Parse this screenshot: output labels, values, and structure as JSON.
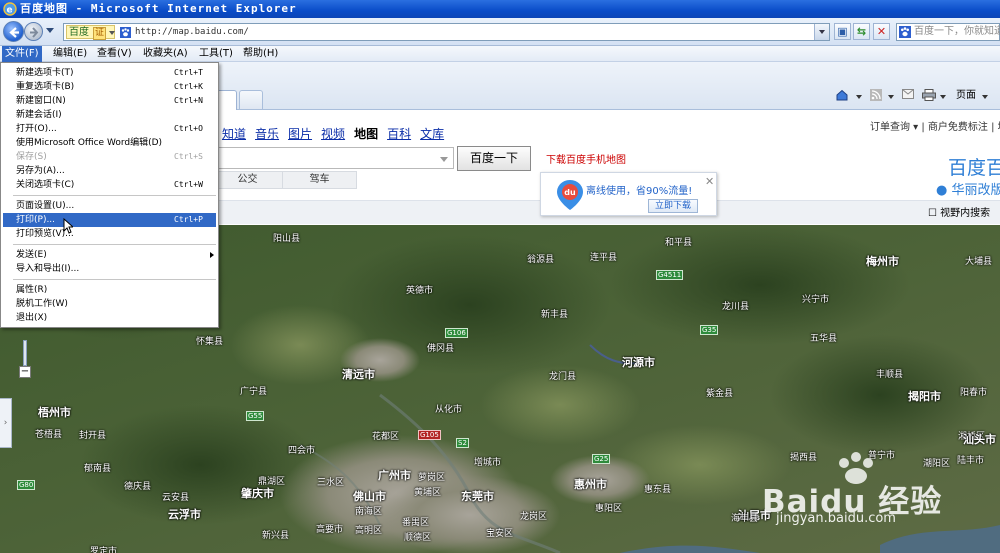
{
  "window": {
    "title": "百度地图 - Microsoft Internet Explorer"
  },
  "address_bar": {
    "site_label": "百度",
    "cert_label": "证",
    "url": "http://map.baidu.com/",
    "search_placeholder": "百度一下，你就知道"
  },
  "menubar": {
    "items": [
      {
        "label": "文件(F)"
      },
      {
        "label": "编辑(E)"
      },
      {
        "label": "查看(V)"
      },
      {
        "label": "收藏夹(A)"
      },
      {
        "label": "工具(T)"
      },
      {
        "label": "帮助(H)"
      }
    ]
  },
  "command_bar": {
    "page_label": "页面"
  },
  "file_menu": {
    "items": [
      {
        "label": "新建选项卡(T)",
        "shortcut": "Ctrl+T"
      },
      {
        "label": "重复选项卡(B)",
        "shortcut": "Ctrl+K"
      },
      {
        "label": "新建窗口(N)",
        "shortcut": "Ctrl+N"
      },
      {
        "label": "新建会话(I)",
        "shortcut": ""
      },
      {
        "label": "打开(O)...",
        "shortcut": "Ctrl+O"
      },
      {
        "label": "使用Microsoft Office Word编辑(D)",
        "shortcut": ""
      },
      {
        "label": "保存(S)",
        "shortcut": "Ctrl+S"
      },
      {
        "label": "另存为(A)...",
        "shortcut": ""
      },
      {
        "label": "关闭选项卡(C)",
        "shortcut": "Ctrl+W"
      },
      {
        "label": "页面设置(U)...",
        "shortcut": ""
      },
      {
        "label": "打印(P)...",
        "shortcut": "Ctrl+P"
      },
      {
        "label": "打印预览(V)...",
        "shortcut": ""
      },
      {
        "label": "发送(E)",
        "shortcut": ""
      },
      {
        "label": "导入和导出(I)...",
        "shortcut": ""
      },
      {
        "label": "属性(R)",
        "shortcut": ""
      },
      {
        "label": "脱机工作(W)",
        "shortcut": ""
      },
      {
        "label": "退出(X)",
        "shortcut": ""
      }
    ]
  },
  "page": {
    "nav_links": [
      "知道",
      "音乐",
      "图片",
      "视频",
      "地图",
      "百科",
      "文库"
    ],
    "top_links": "订单查询 ▾ | 商户免费标注 | 地",
    "search_button": "百度一下",
    "download_link": "下载百度手机地图",
    "route_tabs": [
      "公交",
      "驾车"
    ],
    "brand_logo": "百度百",
    "brand_sub": "● 华丽改版",
    "view_search": "视野内搜索",
    "promo": {
      "text": "离线使用，省90%流量!",
      "button": "立即下载",
      "logo": "du"
    }
  },
  "map": {
    "places": [
      "阳山县",
      "翁源县",
      "连平县",
      "和平县",
      "梅州市",
      "大埔县",
      "英德市",
      "新丰县",
      "龙川县",
      "兴宁市",
      "怀集县",
      "佛冈县",
      "五华县",
      "清远市",
      "龙门县",
      "河源市",
      "丰顺县",
      "广宁县",
      "紫金县",
      "揭阳市",
      "从化市",
      "梧州市",
      "苍梧县",
      "封开县",
      "花都区",
      "增城市",
      "惠州市",
      "陆丰市",
      "普宁市",
      "潮阳区",
      "广州市",
      "东莞市",
      "佛山市",
      "肇庆市",
      "汕尾市",
      "海丰县",
      "惠阳区",
      "惠东县",
      "南海区",
      "番禺区",
      "三水区",
      "黄埔区",
      "萝岗区",
      "鼎湖区",
      "四会市",
      "高要市",
      "德庆县",
      "郁南县",
      "云安县",
      "云浮市",
      "罗定市",
      "高明区",
      "新兴县",
      "顺德区",
      "宝安区",
      "龙岗区",
      "揭西县",
      "湘桥区",
      "汕头市",
      "阳春市"
    ],
    "roads": [
      "G106",
      "G105",
      "G4511",
      "G35",
      "G55",
      "G80",
      "G25",
      "S2"
    ]
  },
  "watermark": {
    "text": "Baidu 经验",
    "url": "jingyan.baidu.com"
  }
}
